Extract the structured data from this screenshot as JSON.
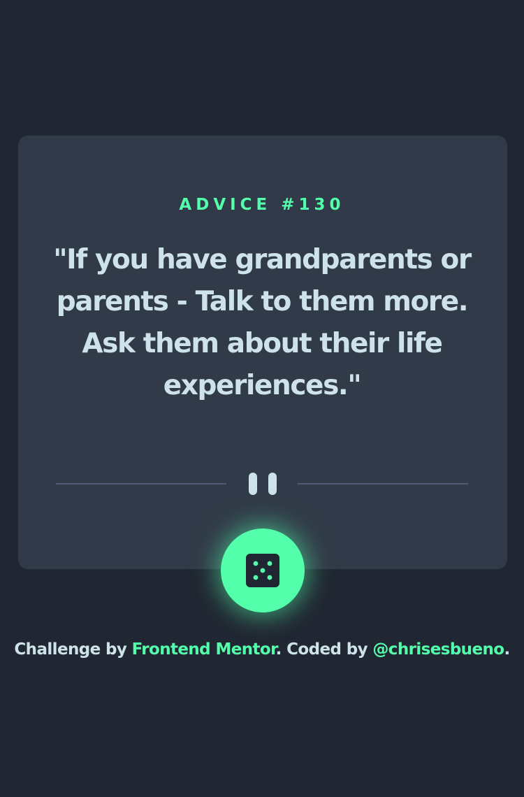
{
  "colors": {
    "background": "#202632",
    "card": "#313a48",
    "accent": "#53ffaa",
    "text": "#cee3e9",
    "divider": "#4f5d74",
    "dice_face": "#202632"
  },
  "advice": {
    "label": "ADVICE #130",
    "quote": "\"If you have grandparents or parents - Talk to them more. Ask them about their life experiences.\""
  },
  "divider": {
    "icon": "pause-icon"
  },
  "dice_button": {
    "icon": "dice-icon"
  },
  "footer": {
    "prefix": "Challenge by ",
    "mentor_link": "Frontend Mentor",
    "middle": ". Coded by ",
    "author_link": "@chrisesbueno",
    "suffix": "."
  }
}
